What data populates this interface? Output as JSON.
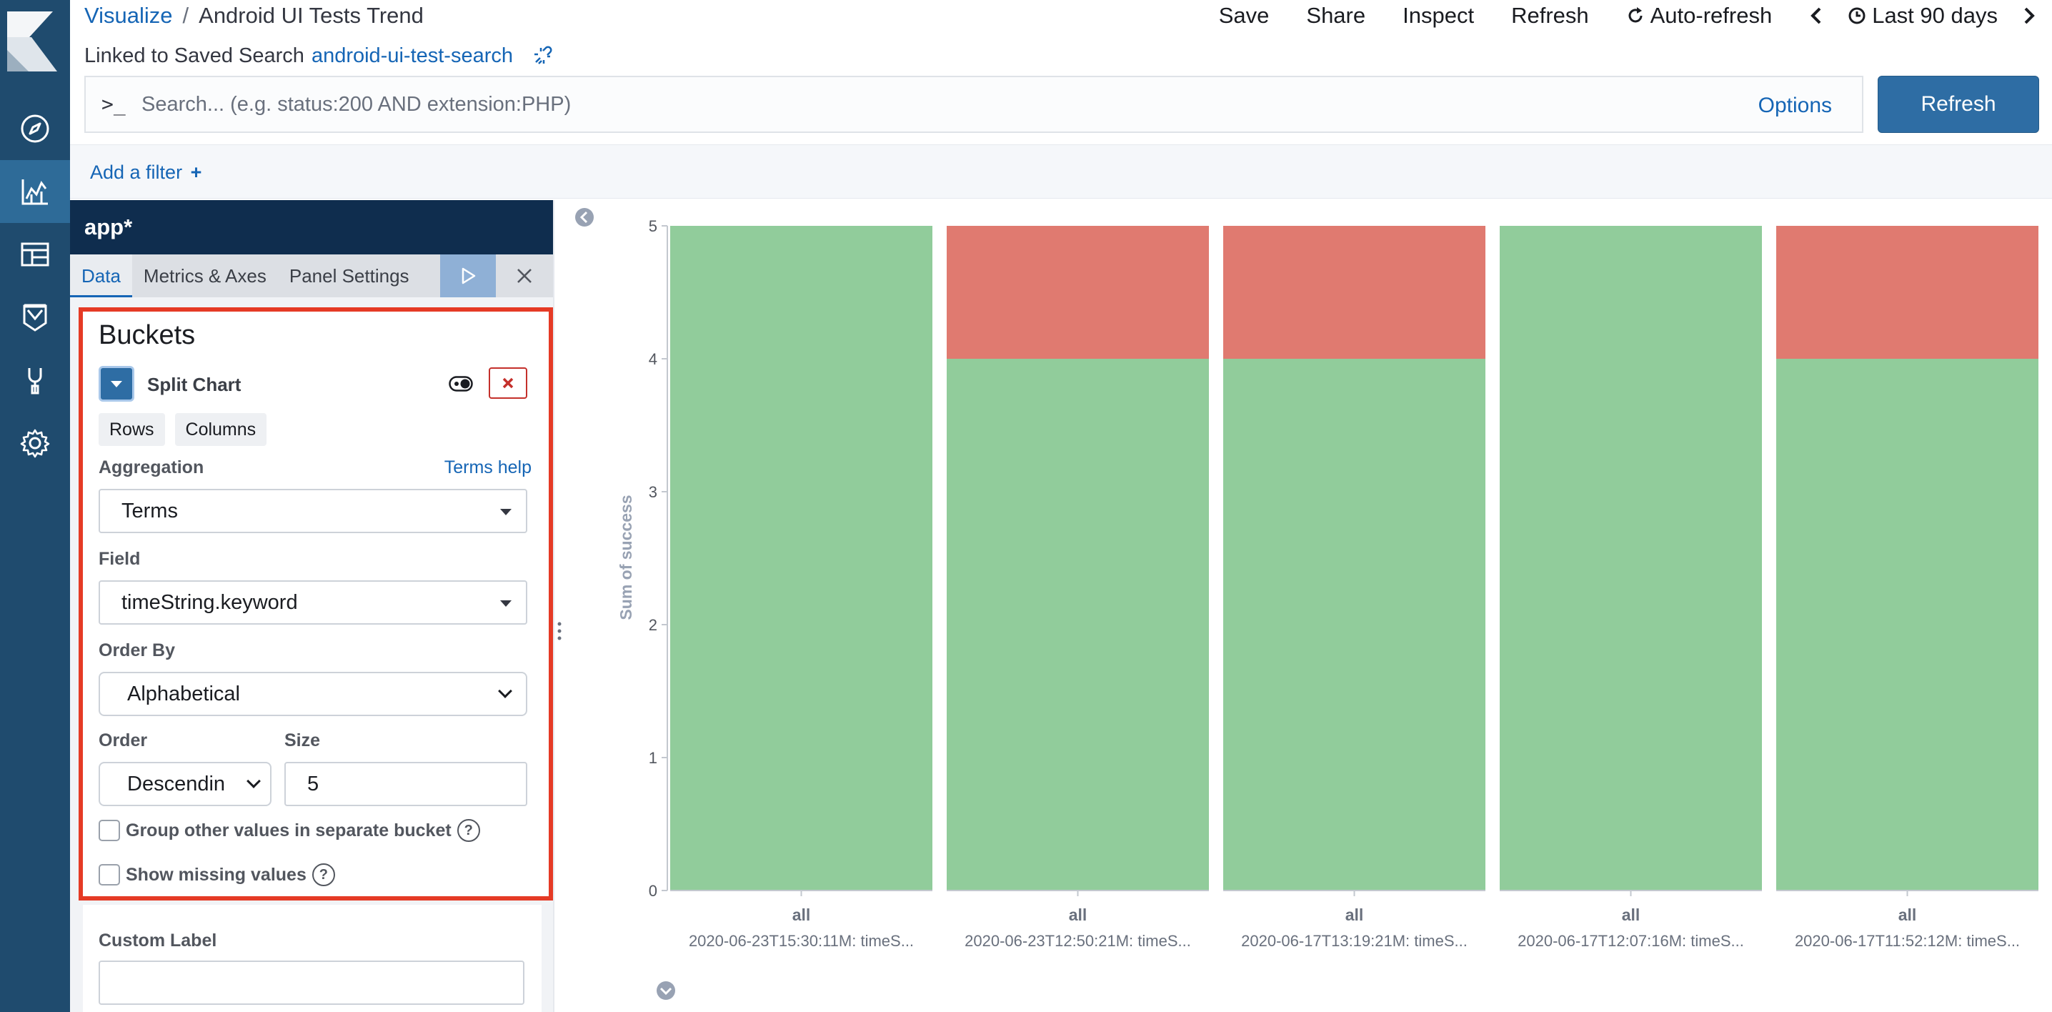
{
  "breadcrumb": {
    "root": "Visualize",
    "separator": "/",
    "current": "Android UI Tests Trend"
  },
  "linked_search": {
    "prefix": "Linked to Saved Search",
    "name": "android-ui-test-search"
  },
  "top_menu": {
    "save": "Save",
    "share": "Share",
    "inspect": "Inspect",
    "refresh": "Refresh",
    "auto_refresh": "Auto-refresh",
    "time_range": "Last 90 days"
  },
  "query": {
    "prompt": ">_",
    "placeholder": "Search... (e.g. status:200 AND extension:PHP)",
    "value": "",
    "options_label": "Options",
    "refresh_button": "Refresh"
  },
  "filter": {
    "add_label": "Add a filter"
  },
  "nav": {
    "icons": [
      "kibana-logo-icon",
      "discover-compass-icon",
      "visualize-icon",
      "dashboard-icon",
      "canvas-icon",
      "dev-tools-icon",
      "management-gear-icon"
    ],
    "active": "visualize-icon"
  },
  "editor": {
    "index_pattern": "app*",
    "tabs": [
      "Data",
      "Metrics & Axes",
      "Panel Settings"
    ],
    "active_tab": "Data",
    "buckets": {
      "title": "Buckets",
      "agg_name": "Split Chart",
      "chips": [
        "Rows",
        "Columns"
      ],
      "aggregation_label": "Aggregation",
      "aggregation_help": "Terms help",
      "aggregation_value": "Terms",
      "field_label": "Field",
      "field_value": "timeString.keyword",
      "order_by_label": "Order By",
      "order_by_value": "Alphabetical",
      "order_label": "Order",
      "order_value": "Descendin",
      "size_label": "Size",
      "size_value": "5",
      "group_other_label": "Group other values in separate bucket",
      "group_other_checked": false,
      "show_missing_label": "Show missing values",
      "show_missing_checked": false
    },
    "custom_label": {
      "label": "Custom Label",
      "value": ""
    }
  },
  "colors": {
    "success": "#91cc9b",
    "failure": "#e07a70",
    "accent": "#1565b5",
    "highlight": "#e53a25"
  },
  "chart_data": {
    "type": "bar",
    "stacked": true,
    "ylabel": "Sum of success",
    "ylim": [
      0,
      5
    ],
    "yticks": [
      0,
      1,
      2,
      3,
      4,
      5
    ],
    "panels": [
      {
        "label": "all",
        "sublabel": "2020-06-23T15:30:11M: timeS...",
        "values": [
          5,
          0
        ]
      },
      {
        "label": "all",
        "sublabel": "2020-06-23T12:50:21M: timeS...",
        "values": [
          4,
          1
        ]
      },
      {
        "label": "all",
        "sublabel": "2020-06-17T13:19:21M: timeS...",
        "values": [
          4,
          1
        ]
      },
      {
        "label": "all",
        "sublabel": "2020-06-17T12:07:16M: timeS...",
        "values": [
          5,
          0
        ]
      },
      {
        "label": "all",
        "sublabel": "2020-06-17T11:52:12M: timeS...",
        "values": [
          4,
          1
        ]
      }
    ]
  }
}
